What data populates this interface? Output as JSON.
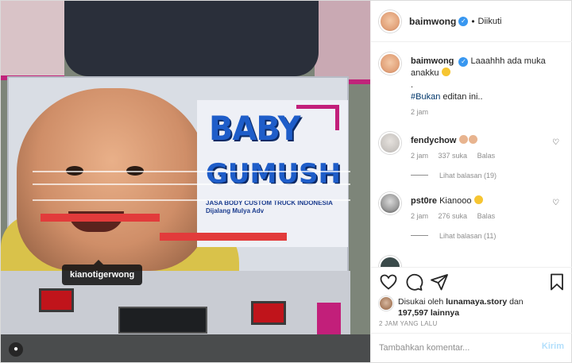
{
  "photo": {
    "tag_label": "kianotigerwong",
    "sign_title_1": "BABY",
    "sign_title_2": "GUMUSH",
    "sign_line": "JASA BODY CUSTOM TRUCK INDONESIA Dijalang Mulya Adv"
  },
  "header": {
    "username": "baimwong",
    "verified_icon": "verified-badge-icon",
    "follow_status": "Diikuti"
  },
  "caption": {
    "username": "baimwong",
    "text": "Laaahhh ada muka anakku",
    "emoji": "laughing-emoji",
    "dot": ".",
    "hashtag": "#Bukan",
    "text_after": " editan ini..",
    "time": "2 jam"
  },
  "comments": [
    {
      "username": "fendychow",
      "text": "",
      "emoji": "clapping-hands-emoji",
      "time": "2 jam",
      "likes": "337 suka",
      "reply": "Balas",
      "view_replies": "Lihat balasan (19)"
    },
    {
      "username": "pst0re",
      "text": "Kianooo",
      "emoji": "heart-eyes-emoji",
      "time": "2 jam",
      "likes": "276 suka",
      "reply": "Balas",
      "view_replies": "Lihat balasan (11)"
    }
  ],
  "actions": {
    "like": "heart-icon",
    "comment": "comment-icon",
    "share": "share-icon",
    "save": "bookmark-icon"
  },
  "likes": {
    "prefix": "Disukai oleh",
    "liker": "lunamaya.story",
    "conj": "dan",
    "count": "197,597 lainnya"
  },
  "timestamp": "2 JAM YANG LALU",
  "compose": {
    "placeholder": "Tambahkan komentar...",
    "send_label": "Kirim"
  },
  "colors": {
    "accent": "#3897f0",
    "hashtag": "#00376b",
    "send_disabled": "#b2dffc",
    "muted": "#8e8e8e"
  }
}
